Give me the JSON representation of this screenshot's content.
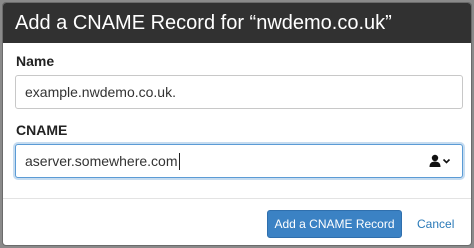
{
  "dialog": {
    "title": "Add a CNAME Record for “nwdemo.co.uk”"
  },
  "name_field": {
    "label": "Name",
    "value": "example.nwdemo.co.uk."
  },
  "cname_field": {
    "label": "CNAME",
    "value": "aserver.somewhere.com",
    "trailing_icon": "user-dropdown-icon"
  },
  "actions": {
    "submit_label": "Add a CNAME Record",
    "cancel_label": "Cancel"
  },
  "colors": {
    "titlebar": "#313131",
    "primary_button": "#3b82c4",
    "link": "#2a7ab8",
    "focus_border": "#5b9bd5"
  }
}
